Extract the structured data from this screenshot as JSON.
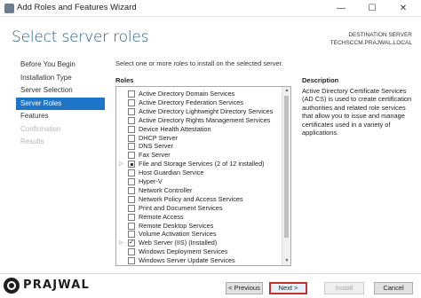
{
  "window": {
    "title": "Add Roles and Features Wizard",
    "minimize_glyph": "—",
    "maximize_glyph": "☐",
    "close_glyph": "✕"
  },
  "header": {
    "page_title": "Select server roles",
    "destination_label": "DESTINATION SERVER",
    "destination_server": "TECHSCCM.PRAJWAL.LOCAL"
  },
  "nav": {
    "items": [
      {
        "label": "Before You Begin",
        "state": "normal"
      },
      {
        "label": "Installation Type",
        "state": "normal"
      },
      {
        "label": "Server Selection",
        "state": "normal"
      },
      {
        "label": "Server Roles",
        "state": "active"
      },
      {
        "label": "Features",
        "state": "normal"
      },
      {
        "label": "Confirmation",
        "state": "disabled"
      },
      {
        "label": "Results",
        "state": "disabled"
      }
    ]
  },
  "main": {
    "instruction": "Select one or more roles to install on the selected server.",
    "roles_label": "Roles",
    "roles": [
      {
        "label": "Active Directory Domain Services",
        "checked": false,
        "expandable": false
      },
      {
        "label": "Active Directory Federation Services",
        "checked": false,
        "expandable": false
      },
      {
        "label": "Active Directory Lightweight Directory Services",
        "checked": false,
        "expandable": false
      },
      {
        "label": "Active Directory Rights Management Services",
        "checked": false,
        "expandable": false
      },
      {
        "label": "Device Health Attestation",
        "checked": false,
        "expandable": false
      },
      {
        "label": "DHCP Server",
        "checked": false,
        "expandable": false
      },
      {
        "label": "DNS Server",
        "checked": false,
        "expandable": false
      },
      {
        "label": "Fax Server",
        "checked": false,
        "expandable": false
      },
      {
        "label": "File and Storage Services (2 of 12 installed)",
        "checked": "partial",
        "expandable": true
      },
      {
        "label": "Host Guardian Service",
        "checked": false,
        "expandable": false
      },
      {
        "label": "Hyper-V",
        "checked": false,
        "expandable": false
      },
      {
        "label": "Network Controller",
        "checked": false,
        "expandable": false
      },
      {
        "label": "Network Policy and Access Services",
        "checked": false,
        "expandable": false
      },
      {
        "label": "Print and Document Services",
        "checked": false,
        "expandable": false
      },
      {
        "label": "Remote Access",
        "checked": false,
        "expandable": false
      },
      {
        "label": "Remote Desktop Services",
        "checked": false,
        "expandable": false
      },
      {
        "label": "Volume Activation Services",
        "checked": false,
        "expandable": false
      },
      {
        "label": "Web Server (IIS) (Installed)",
        "checked": true,
        "expandable": true
      },
      {
        "label": "Windows Deployment Services",
        "checked": false,
        "expandable": false
      },
      {
        "label": "Windows Server Update Services",
        "checked": false,
        "expandable": false
      }
    ]
  },
  "description": {
    "label": "Description",
    "text": "Active Directory Certificate Services (AD CS) is used to create certification authorities and related role services that allow you to issue and manage certificates used in a variety of applications."
  },
  "footer": {
    "previous_label": "< Previous",
    "next_label": "Next >",
    "install_label": "Install",
    "cancel_label": "Cancel"
  },
  "watermark": {
    "text": "PRAJWAL"
  },
  "colors": {
    "accent": "#1e74c7",
    "title": "#1e5a8a",
    "highlight_border": "#c4302b"
  }
}
